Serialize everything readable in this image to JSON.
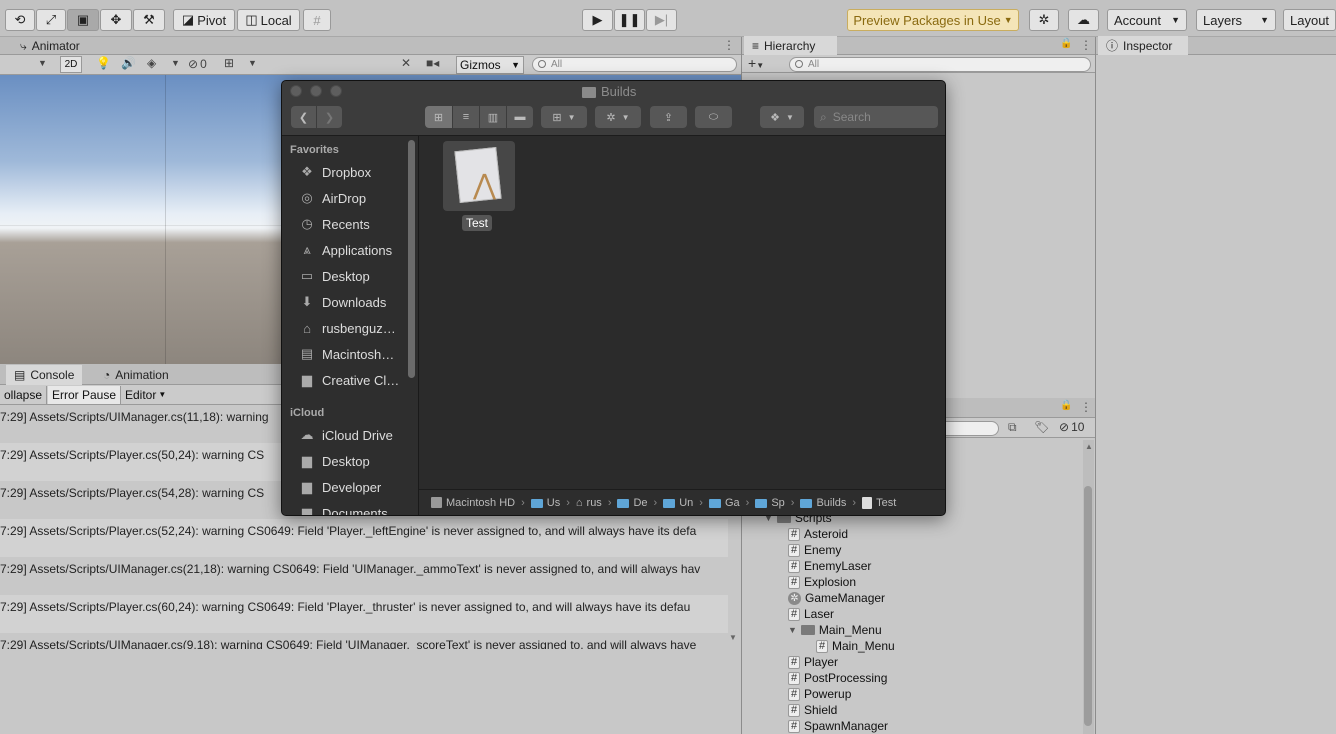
{
  "toolbar": {
    "pivot": "Pivot",
    "local": "Local",
    "preview_packages": "Preview Packages in Use",
    "account": "Account",
    "layers": "Layers",
    "layout": "Layout",
    "colors": {
      "preview_bg": "#f4e5b8",
      "preview_text": "#8a6a10"
    }
  },
  "scene": {
    "tab": "Animator",
    "mode_2d": "2D",
    "hidden_count": "0",
    "gizmos": "Gizmos",
    "search_placeholder": "All"
  },
  "hierarchy": {
    "tab": "Hierarchy",
    "search_placeholder": "All"
  },
  "inspector": {
    "tab": "Inspector"
  },
  "console": {
    "tabs": [
      "Console",
      "Animation"
    ],
    "buttons": [
      "ollapse",
      "Error Pause",
      "Editor"
    ],
    "rows": [
      "7:29] Assets/Scripts/UIManager.cs(11,18): warning",
      "7:29] Assets/Scripts/Player.cs(50,24): warning CS",
      "7:29] Assets/Scripts/Player.cs(54,28): warning CS",
      "7:29] Assets/Scripts/Player.cs(52,24): warning CS0649: Field 'Player._leftEngine' is never assigned to, and will always have its defa",
      "7:29] Assets/Scripts/UIManager.cs(21,18): warning CS0649: Field 'UIManager._ammoText' is never assigned to, and will always hav",
      "7:29] Assets/Scripts/Player.cs(60,24): warning CS0649: Field 'Player._thruster' is never assigned to, and will always have its defau",
      "7:29] Assets/Scripts/UIManager.cs(9,18): warning CS0649: Field 'UIManager._scoreText' is never assigned to, and will always have"
    ]
  },
  "project": {
    "hidden_count": "10",
    "items": [
      {
        "label": "Scripts",
        "type": "folder-open",
        "indent": 0
      },
      {
        "label": "Asteroid",
        "type": "script",
        "indent": 1
      },
      {
        "label": "Enemy",
        "type": "script",
        "indent": 1
      },
      {
        "label": "EnemyLaser",
        "type": "script",
        "indent": 1
      },
      {
        "label": "Explosion",
        "type": "script",
        "indent": 1
      },
      {
        "label": "GameManager",
        "type": "gear",
        "indent": 1
      },
      {
        "label": "Laser",
        "type": "script",
        "indent": 1
      },
      {
        "label": "Main_Menu",
        "type": "folder-open",
        "indent": 1
      },
      {
        "label": "Main_Menu",
        "type": "script",
        "indent": 2
      },
      {
        "label": "Player",
        "type": "script",
        "indent": 1
      },
      {
        "label": "PostProcessing",
        "type": "script",
        "indent": 1
      },
      {
        "label": "Powerup",
        "type": "script",
        "indent": 1
      },
      {
        "label": "Shield",
        "type": "script",
        "indent": 1
      },
      {
        "label": "SpawnManager",
        "type": "script",
        "indent": 1
      }
    ]
  },
  "finder": {
    "title": "Builds",
    "search_placeholder": "Search",
    "favorites_header": "Favorites",
    "favorites": [
      {
        "label": "Dropbox",
        "icon": "dropbox-icon"
      },
      {
        "label": "AirDrop",
        "icon": "airdrop-icon"
      },
      {
        "label": "Recents",
        "icon": "clock-icon"
      },
      {
        "label": "Applications",
        "icon": "applications-icon"
      },
      {
        "label": "Desktop",
        "icon": "desktop-icon"
      },
      {
        "label": "Downloads",
        "icon": "download-icon"
      },
      {
        "label": "rusbenguz…",
        "icon": "home-icon"
      },
      {
        "label": "Macintosh…",
        "icon": "disk-icon"
      },
      {
        "label": "Creative Cl…",
        "icon": "folder-icon"
      }
    ],
    "icloud_header": "iCloud",
    "icloud": [
      {
        "label": "iCloud Drive",
        "icon": "cloud-icon"
      },
      {
        "label": "Desktop",
        "icon": "folder-icon"
      },
      {
        "label": "Developer",
        "icon": "folder-icon"
      },
      {
        "label": "Documents",
        "icon": "folder-icon"
      }
    ],
    "file": {
      "label": "Test",
      "icon": "app-icon"
    },
    "path": [
      "Macintosh HD",
      "Us",
      "rus",
      "De",
      "Un",
      "Ga",
      "Sp",
      "Builds",
      "Test"
    ]
  }
}
